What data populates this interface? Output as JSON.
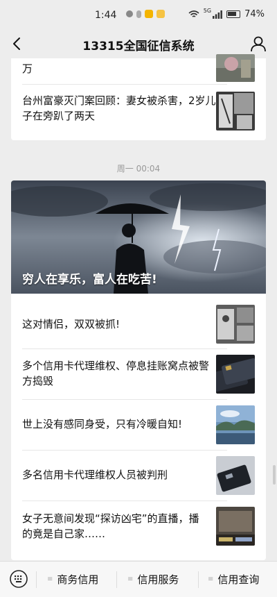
{
  "status": {
    "time": "1:44",
    "battery": "74%",
    "network": "5G"
  },
  "nav": {
    "title": "13315全国征信系统"
  },
  "top_items": [
    {
      "title": "万"
    },
    {
      "title": "台州富豪灭门案回顾：妻女被杀害，2岁儿子在旁趴了两天"
    }
  ],
  "time_separator": "周一 00:04",
  "hero": {
    "title": "穷人在享乐，富人在吃苦!"
  },
  "articles": [
    {
      "title": "这对情侣，双双被抓!"
    },
    {
      "title": "多个信用卡代理维权、停息挂账窝点被警方捣毁"
    },
    {
      "title": "世上没有感同身受，只有冷暖自知!"
    },
    {
      "title": "多名信用卡代理维权人员被判刑"
    },
    {
      "title": "女子无意间发现“探访凶宅”的直播，播的竟是自己家……"
    }
  ],
  "bottom_menu": [
    {
      "label": "商务信用"
    },
    {
      "label": "信用服务"
    },
    {
      "label": "信用查询"
    }
  ],
  "colors": {
    "background": "#ededed",
    "card": "#ffffff",
    "separator_text": "#999999"
  }
}
